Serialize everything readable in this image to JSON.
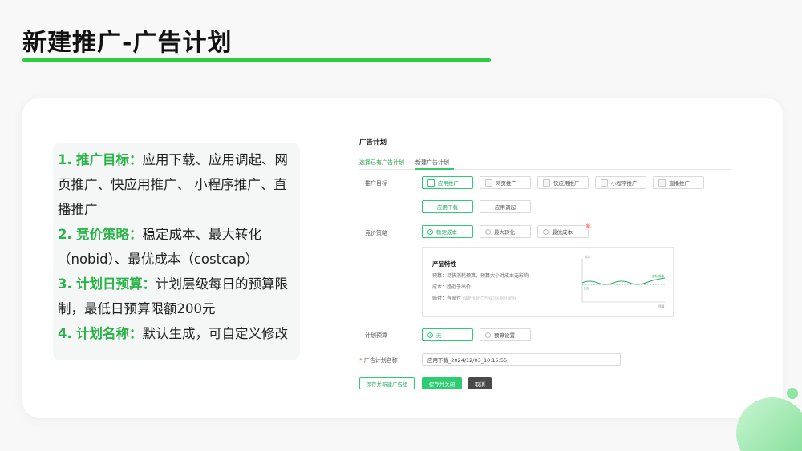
{
  "slide": {
    "title": "新建推广-广告计划"
  },
  "notes": [
    {
      "num": "1.",
      "key": "推广目标：",
      "text": "应用下载、应用调起、网页推广、快应用推广、 小程序推广、直播推广"
    },
    {
      "num": "2.",
      "key": "竞价策略：",
      "text": "稳定成本、最大转化（nobid）、最优成本（costcap）"
    },
    {
      "num": "3.",
      "key": "计划日预算：",
      "text": "计划层级每日的预算限制，最低日预算限额200元"
    },
    {
      "num": "4.",
      "key": "计划名称：",
      "text": "默认生成，可自定义修改"
    }
  ],
  "form": {
    "title": "广告计划",
    "tabs": [
      {
        "label": "选择已有广告计划"
      },
      {
        "label": "新建广告计划"
      }
    ],
    "goal": {
      "label": "推广目标",
      "options": [
        "应用推广",
        "网页推广",
        "快应用推广",
        "小程序推广",
        "直播推广"
      ],
      "sub_options": [
        "应用下载",
        "应用调起"
      ]
    },
    "bid": {
      "label": "竞价策略",
      "options": [
        "稳定成本",
        "最大转化",
        "最优成本"
      ],
      "new_badge": "新"
    },
    "info": {
      "title": "产品特性",
      "lines": [
        {
          "k": "预算",
          "v": "尽快消耗预算，预算大小对成本无影响"
        },
        {
          "k": "成本",
          "v": "趋近于出价"
        },
        {
          "k": "赔付",
          "v": "有赔付",
          "sub": "(满足\"6同\"广告/OCPX 赔付规则)"
        }
      ],
      "chart": {
        "y_label": "成本",
        "x_label": "预算",
        "actual_label": "实际成本",
        "bid_label": "出价"
      }
    },
    "budget": {
      "label": "计划预算",
      "options": [
        "无",
        "预算设置"
      ]
    },
    "name": {
      "label": "广告计划名称",
      "required_mark": "*",
      "value": "应用下载_2024/12/03_10:15:55"
    },
    "buttons": {
      "save_new": "保存并新建广告组",
      "save_close": "保存并关闭",
      "cancel": "取消"
    }
  },
  "colors": {
    "accent": "#2ecc71",
    "title_underline": "#2ecc40",
    "key_text": "#29b34a"
  }
}
